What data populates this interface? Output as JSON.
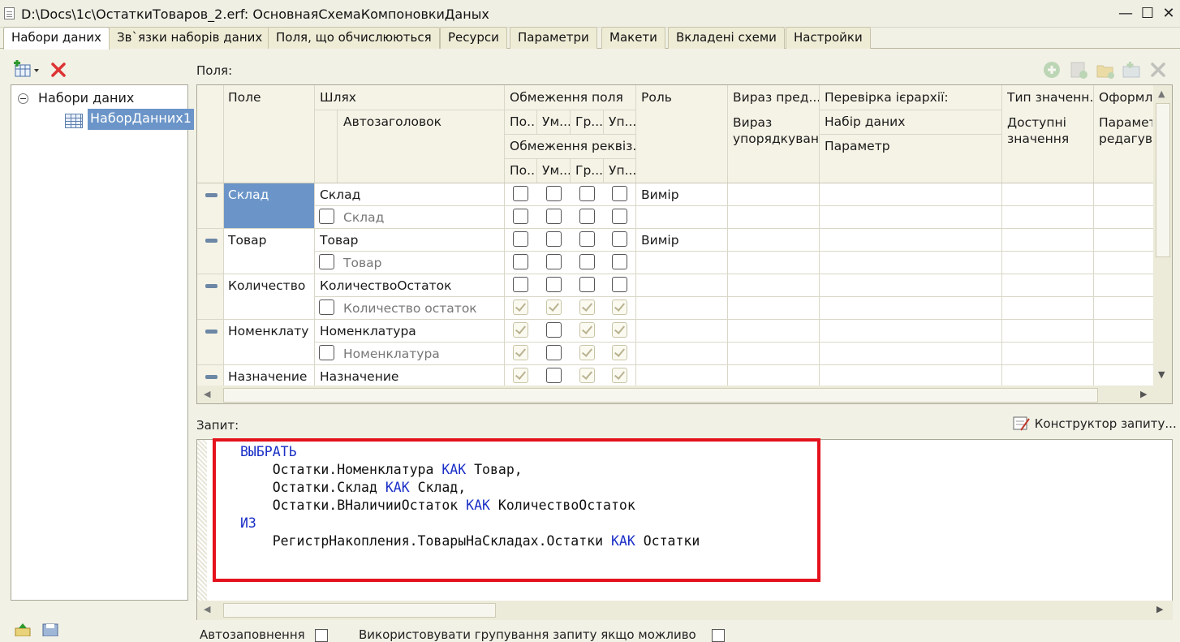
{
  "window": {
    "title": "D:\\Docs\\1c\\ОстаткиТоваров_2.erf: ОсновнаяСхемаКомпоновкиДаных",
    "minimize": "—",
    "maximize": "☐",
    "close": "✕"
  },
  "tabs": [
    {
      "label": "Набори даних"
    },
    {
      "label": "Зв`язки наборів даних"
    },
    {
      "label": "Поля, що обчислюються"
    },
    {
      "label": "Ресурси"
    },
    {
      "label": "Параметри"
    },
    {
      "label": "Макети"
    },
    {
      "label": "Вкладені схеми"
    },
    {
      "label": "Настройки"
    }
  ],
  "tree": {
    "root": "Набори даних",
    "child": "НаборДанних1"
  },
  "fields_label": "Поля:",
  "grid": {
    "headers": {
      "field": "Поле",
      "path": "Шлях",
      "autotitle": "Автозаголовок",
      "field_restrictions": "Обмеження поля",
      "restr_cols": [
        "По..",
        "Ум...",
        "Гр...",
        "Уп..."
      ],
      "attr_restrictions": "Обмеження реквіз...",
      "role": "Роль",
      "order_expr": "Вираз пред...",
      "order_expr2": "Вираз упорядкуван",
      "hier_check": "Перевірка ієрархії:",
      "dataset": "Набір даних",
      "parameter": "Параметр",
      "value_type": "Тип значенн...",
      "avail_values": "Доступні значення",
      "format": "Оформл...",
      "edit_params": "Парамет редагува"
    },
    "rows": [
      {
        "field": "Склад",
        "path": "Склад",
        "title": "Склад",
        "role": "Вимір",
        "checks1": [
          false,
          false,
          false,
          false
        ],
        "checks2": [
          false,
          false,
          false,
          false
        ],
        "selected": true
      },
      {
        "field": "Товар",
        "path": "Товар",
        "title": "Товар",
        "role": "Вимір",
        "checks1": [
          false,
          false,
          false,
          false
        ],
        "checks2": [
          false,
          false,
          false,
          false
        ]
      },
      {
        "field": "Количество",
        "path": "КоличествоОстаток",
        "title": "Количество остаток",
        "role": "",
        "checks1": [
          false,
          false,
          false,
          false
        ],
        "checks2": [
          true,
          true,
          true,
          true
        ]
      },
      {
        "field": "Номенклату",
        "path": "Номенклатура",
        "title": "Номенклатура",
        "role": "",
        "checks1": [
          true,
          false,
          true,
          true
        ],
        "checks2": [
          true,
          false,
          true,
          true
        ]
      },
      {
        "field": "Назначение",
        "path": "Назначение",
        "title": "",
        "role": "",
        "checks1": [
          true,
          false,
          true,
          true
        ],
        "checks2": []
      }
    ]
  },
  "query": {
    "label": "Запит:",
    "constructor": "Конструктор запиту...",
    "lines": [
      {
        "kw": "ВЫБРАТЬ",
        "text": "",
        "indent": 0
      },
      {
        "pre": "Остатки.Номенклатура ",
        "kw": "КАК",
        "post": " Товар,",
        "indent": 1
      },
      {
        "pre": "Остатки.Склад ",
        "kw": "КАК",
        "post": " Склад,",
        "indent": 1
      },
      {
        "pre": "Остатки.ВНаличииОстаток ",
        "kw": "КАК",
        "post": " КоличествоОстаток",
        "indent": 1
      },
      {
        "kw": "ИЗ",
        "text": "",
        "indent": 0
      },
      {
        "pre": "РегистрНакопления.ТоварыНаСкладах.Остатки ",
        "kw": "КАК",
        "post": " Остатки",
        "indent": 1
      }
    ]
  },
  "bottom": {
    "autofill": "Автозаповнення",
    "use_grouping": "Використовувати групування запиту якщо можливо"
  }
}
